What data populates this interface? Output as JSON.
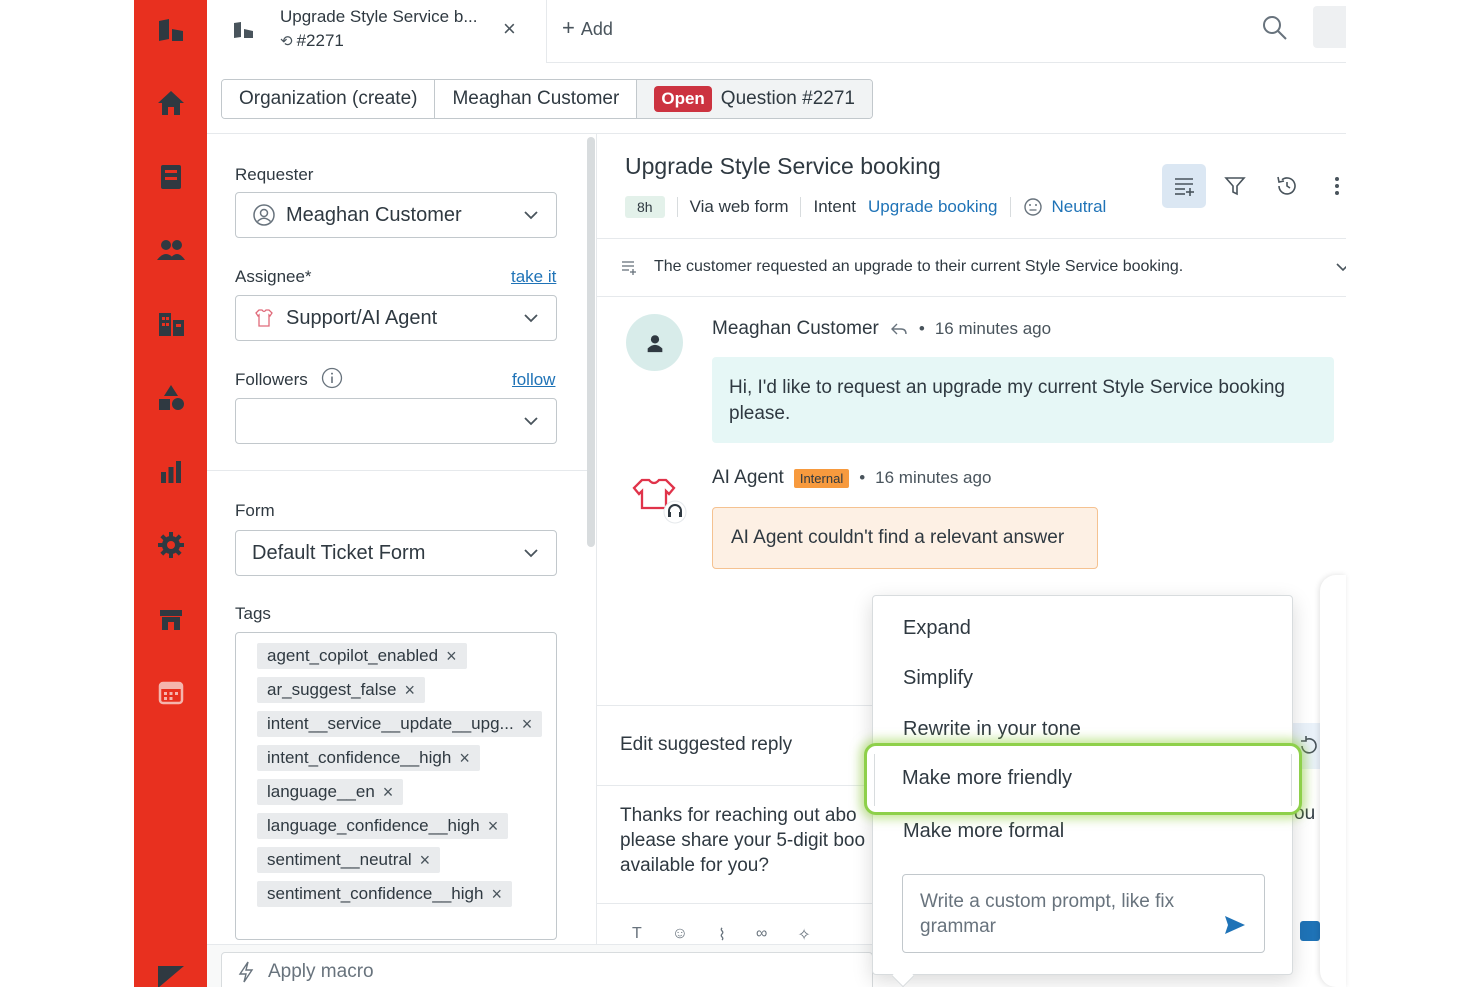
{
  "tab": {
    "title": "Upgrade Style Service b...",
    "ticket_ref": "#2271",
    "add_label": "Add"
  },
  "breadcrumbs": {
    "organization": "Organization (create)",
    "customer": "Meaghan Customer",
    "status_badge": "Open",
    "ticket": "Question #2271"
  },
  "form": {
    "requester_label": "Requester",
    "requester_value": "Meaghan Customer",
    "assignee_label": "Assignee*",
    "take_it": "take it",
    "assignee_value": "Support/AI Agent",
    "followers_label": "Followers",
    "follow": "follow",
    "followers_value": "",
    "form_label": "Form",
    "form_value": "Default Ticket Form",
    "tags_label": "Tags",
    "tags": [
      "agent_copilot_enabled",
      "ar_suggest_false",
      "intent__service__update__upg...",
      "intent_confidence__high",
      "language__en",
      "language_confidence__high",
      "sentiment__neutral",
      "sentiment_confidence__high"
    ]
  },
  "conversation": {
    "title": "Upgrade Style Service booking",
    "age": "8h",
    "via": "Via web form",
    "intent_label": "Intent",
    "intent_value": "Upgrade booking",
    "sentiment": "Neutral",
    "summary": "The customer requested an upgrade to their current Style Service booking.",
    "messages": [
      {
        "author": "Meaghan Customer",
        "time": "16 minutes ago",
        "text": "Hi, I'd like to request an upgrade my current Style Service booking please."
      },
      {
        "author": "AI Agent",
        "badge": "Internal",
        "time": "16 minutes ago",
        "text": "AI Agent couldn't find a relevant answer"
      }
    ],
    "bullet": "•"
  },
  "reply": {
    "heading": "Edit suggested reply",
    "line1": "Thanks for reaching out abo",
    "line2": "please share your 5-digit boo",
    "line3": "available for you?",
    "partial_right": "ou"
  },
  "macro": {
    "label": "Apply macro"
  },
  "popup": {
    "items": [
      "Expand",
      "Simplify",
      "Rewrite in your tone",
      "Make more friendly",
      "Make more formal"
    ],
    "prompt_placeholder": "Write a custom prompt, like fix grammar"
  },
  "colors": {
    "rail": "#e8301f",
    "accent_blue": "#1f73b7",
    "open_badge": "#cc3340",
    "internal_badge": "#f79a3e",
    "highlight": "#8ed04a"
  }
}
